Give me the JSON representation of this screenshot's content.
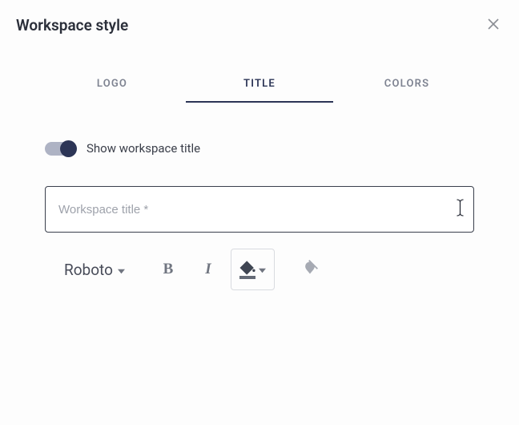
{
  "header": {
    "title": "Workspace style"
  },
  "tabs": {
    "logo": "LOGO",
    "title": "TITLE",
    "colors": "COLORS",
    "active": "title"
  },
  "toggle": {
    "label": "Show workspace title",
    "on": true
  },
  "title_input": {
    "placeholder": "Workspace title *",
    "value": ""
  },
  "toolbar": {
    "font": "Roboto"
  }
}
